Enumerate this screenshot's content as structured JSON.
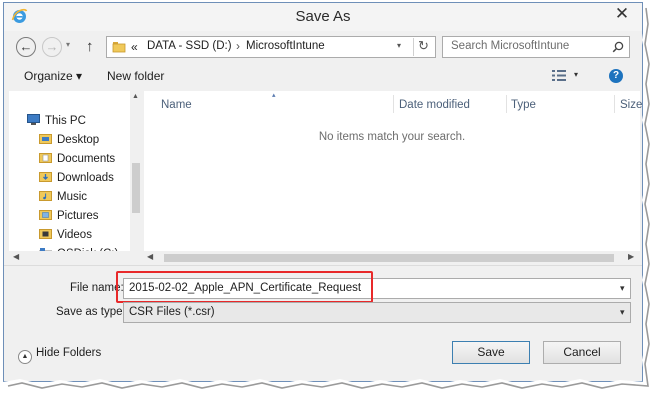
{
  "window": {
    "title": "Save As"
  },
  "nav": {
    "back": "←",
    "forward": "→",
    "up": "↑"
  },
  "address": {
    "chevron": "«",
    "segments": [
      "DATA - SSD (D:)",
      "MicrosoftIntune"
    ],
    "sep": "›"
  },
  "search": {
    "placeholder": "Search MicrosoftIntune"
  },
  "toolbar": {
    "organize": "Organize ▾",
    "new_folder": "New folder"
  },
  "sidebar": {
    "items": [
      {
        "label": "This PC",
        "icon": "computer-icon"
      },
      {
        "label": "Desktop",
        "icon": "folder-icon"
      },
      {
        "label": "Documents",
        "icon": "folder-icon"
      },
      {
        "label": "Downloads",
        "icon": "folder-icon"
      },
      {
        "label": "Music",
        "icon": "folder-icon"
      },
      {
        "label": "Pictures",
        "icon": "folder-icon"
      },
      {
        "label": "Videos",
        "icon": "folder-icon"
      },
      {
        "label": "OSDisk (C:)",
        "icon": "drive-icon"
      }
    ]
  },
  "file_list": {
    "columns": [
      "Name",
      "Date modified",
      "Type",
      "Size"
    ],
    "empty_message": "No items match your search."
  },
  "form": {
    "filename_label": "File name:",
    "filename_value": "2015-02-02_Apple_APN_Certificate_Request",
    "savetype_label": "Save as type:",
    "savetype_value": "CSR Files (*.csr)"
  },
  "footer": {
    "hide_folders": "Hide Folders",
    "save": "Save",
    "cancel": "Cancel"
  },
  "colors": {
    "highlight": "#e8292a",
    "accent": "#1e73be"
  }
}
